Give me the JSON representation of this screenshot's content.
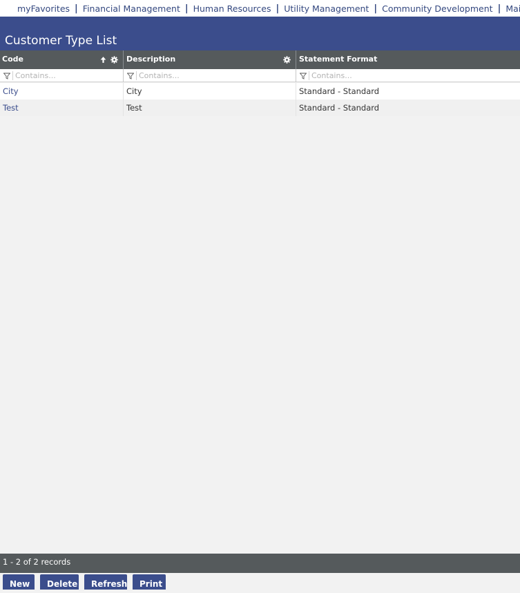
{
  "nav": {
    "items": [
      "myFavorites",
      "Financial Management",
      "Human Resources",
      "Utility Management",
      "Community Development",
      "Maintenance"
    ],
    "separator": "|"
  },
  "page": {
    "title": "Customer Type List"
  },
  "grid": {
    "columns": [
      {
        "label": "Code",
        "sorted": "ascending",
        "icons": [
          "sort-up-icon",
          "gear-icon"
        ]
      },
      {
        "label": "Description",
        "icons": [
          "gear-icon"
        ]
      },
      {
        "label": "Statement Format",
        "icons": []
      }
    ],
    "filter_placeholder": "Contains...",
    "rows": [
      {
        "code": "City",
        "description": "City",
        "statement_format": "Standard - Standard"
      },
      {
        "code": "Test",
        "description": "Test",
        "statement_format": "Standard - Standard"
      }
    ]
  },
  "footer": {
    "record_count": "1 - 2 of 2 records"
  },
  "buttons": {
    "new": "New",
    "delete": "Delete",
    "refresh": "Refresh",
    "print": "Print"
  },
  "colors": {
    "brand": "#3b4d8c",
    "header_bg": "#555a5c",
    "link": "#3b4d8c"
  }
}
